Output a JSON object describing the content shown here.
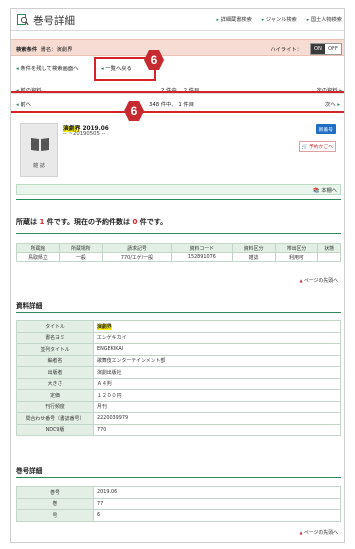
{
  "header": {
    "title": "巻号詳細",
    "links": [
      "詳細蔵書検索",
      "ジャンル検索",
      "国土人物検索"
    ]
  },
  "search_condition": {
    "label": "検索条件",
    "text": "書名：演劇界",
    "highlight_label": "ハイライト：",
    "toggle_on": "ON",
    "toggle_off": "OFF"
  },
  "refine": {
    "keep_condition": "条件を残して検索画面へ",
    "back_to_list": "一覧へ戻る"
  },
  "nav_top": {
    "prev": "前の資料",
    "position": "2 件中、 2 件目",
    "next": "次の資料"
  },
  "nav_issue": {
    "prev": "前へ",
    "position": "348 件中、 1 件目",
    "next": "次へ"
  },
  "annotations": {
    "badge": "6"
  },
  "item": {
    "thumb_caption": "雑 誌",
    "title": "演劇界",
    "volume": "2019.06",
    "sub": "-- ~20190505 --",
    "new_badge": "新着号",
    "reserve_label": "予約かごへ"
  },
  "bookshelf_link": "本棚へ",
  "holding": {
    "prefix": "所蔵は ",
    "count": "1",
    "mid": " 件です。現在の予約件数は ",
    "reservations": "0",
    "suffix": " 件です。"
  },
  "holdings_table": {
    "headers": [
      "所蔵館",
      "所蔵場所",
      "請求記号",
      "資料コード",
      "資料区分",
      "帯出区分",
      "状態"
    ],
    "rows": [
      [
        "鳥取県立",
        "一般",
        "770/エゲ/一般",
        "152891076",
        "雑誌",
        "利用可",
        ""
      ]
    ]
  },
  "to_top": "ページの先頭へ",
  "detail": {
    "heading": "資料詳細",
    "rows": [
      {
        "k": "タイトル",
        "v": "演劇界"
      },
      {
        "k": "書名ヨミ",
        "v": "エンゲキカイ"
      },
      {
        "k": "並列タイトル",
        "v": "ENGEKIKAI"
      },
      {
        "k": "編者名",
        "v": "歌舞伎エンターテインメント部"
      },
      {
        "k": "出版者",
        "v": "演劇出版社"
      },
      {
        "k": "大きさ",
        "v": "Ａ４判"
      },
      {
        "k": "定価",
        "v": "１２００円"
      },
      {
        "k": "刊行頻度",
        "v": "月刊"
      },
      {
        "k": "問合わせ番号（書誌番号）",
        "v": "2220039979"
      },
      {
        "k": "NDC9版",
        "v": "770"
      }
    ]
  },
  "issue": {
    "heading": "巻号詳細",
    "rows": [
      {
        "k": "巻号",
        "v": "2019.06"
      },
      {
        "k": "巻",
        "v": "77"
      },
      {
        "k": "号",
        "v": "6"
      }
    ]
  },
  "colors": {
    "accent": "#2a8a5a",
    "annotation": "#d5232a",
    "highlight": "#fff200"
  }
}
